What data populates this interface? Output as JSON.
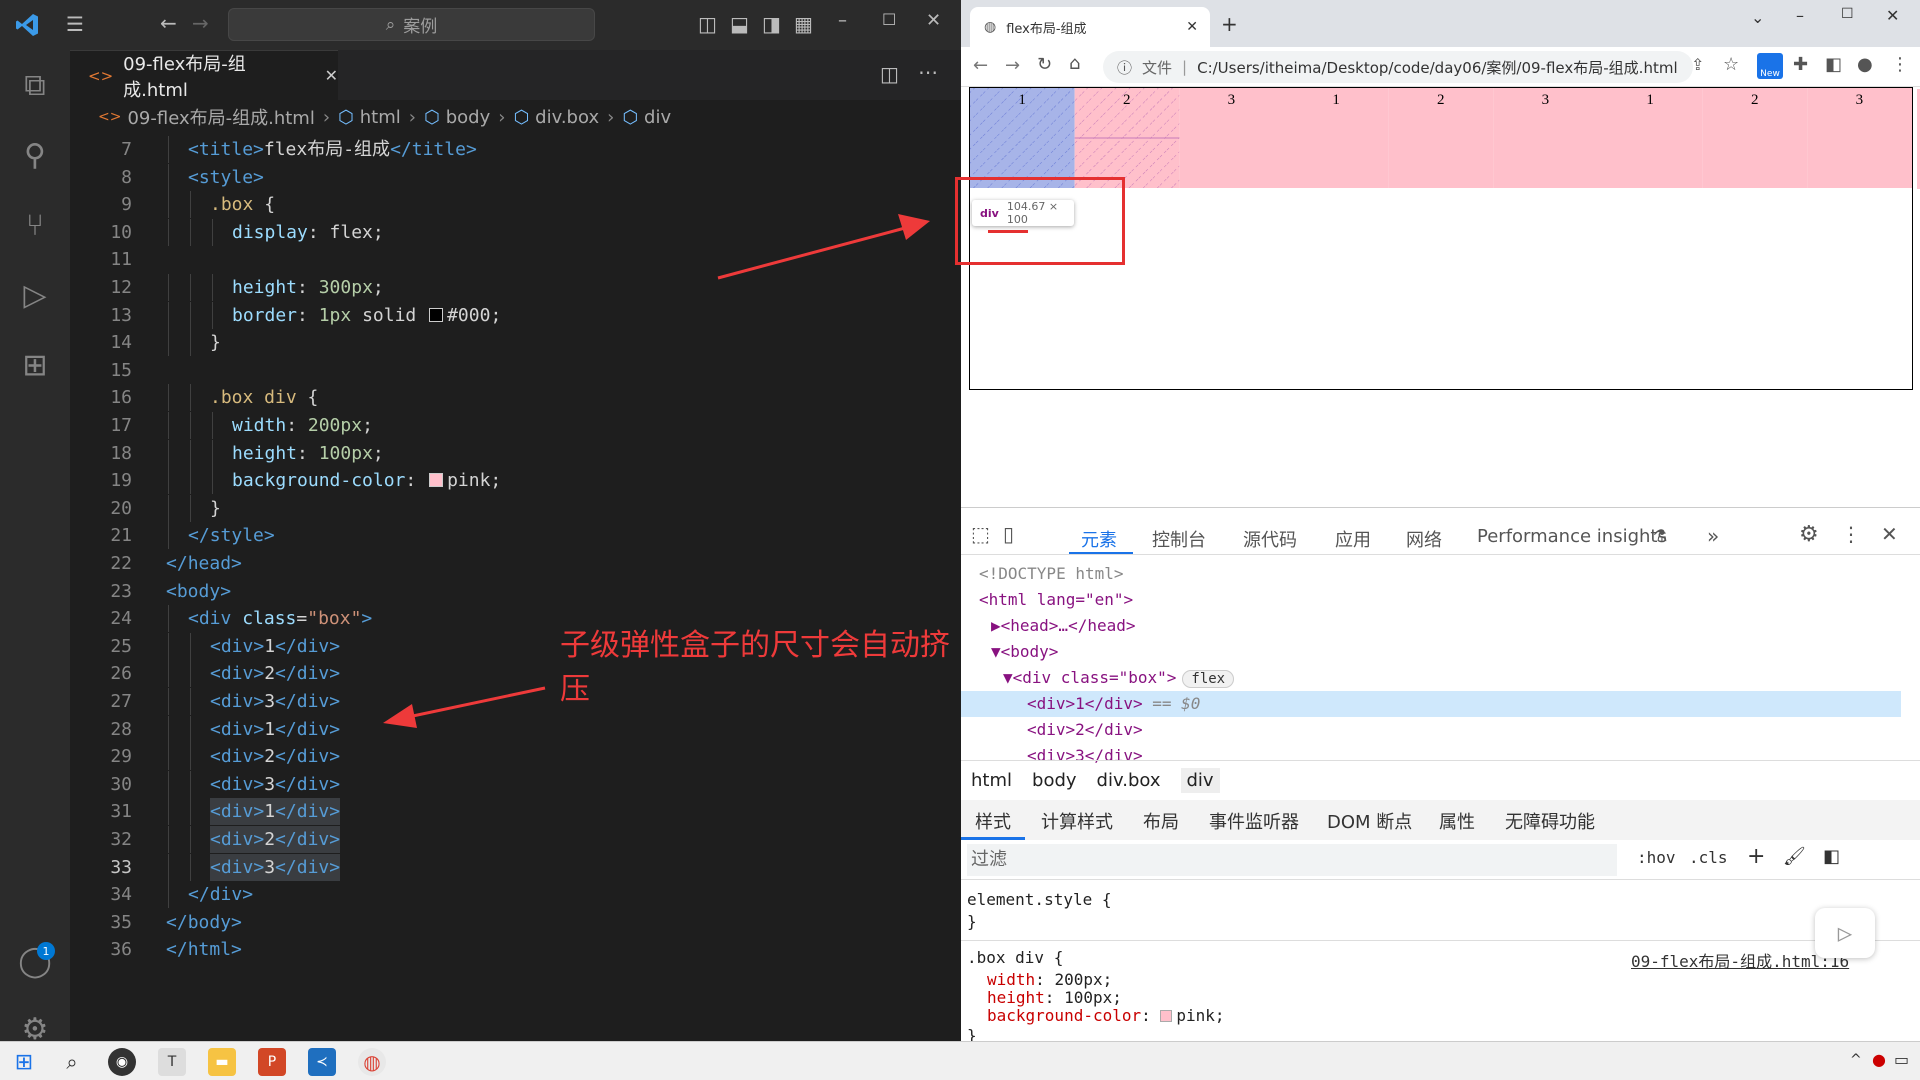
{
  "vscode": {
    "search_text": "案例",
    "tab_label": "09-flex布局-组成.html",
    "breadcrumb": [
      "09-flex布局-组成.html",
      "html",
      "body",
      "div.box",
      "div"
    ],
    "account_badge": "1",
    "lines": [
      {
        "n": "7",
        "parts": [
          [
            "t",
            "<"
          ],
          [
            "t",
            "title"
          ],
          [
            "t",
            ">"
          ],
          [
            "txt",
            "flex布局-组成"
          ],
          [
            "t",
            "</"
          ],
          [
            "t",
            "title"
          ],
          [
            "t",
            ">"
          ]
        ],
        "indent": 1
      },
      {
        "n": "8",
        "parts": [
          [
            "t",
            "<"
          ],
          [
            "t",
            "style"
          ],
          [
            "t",
            ">"
          ]
        ],
        "indent": 1
      },
      {
        "n": "9",
        "parts": [
          [
            "sel",
            ".box"
          ],
          [
            "txt",
            " {"
          ]
        ],
        "indent": 2
      },
      {
        "n": "10",
        "parts": [
          [
            "pr",
            "display"
          ],
          [
            "txt",
            ": flex;"
          ]
        ],
        "indent": 3
      },
      {
        "n": "11",
        "parts": [],
        "indent": 0
      },
      {
        "n": "12",
        "parts": [
          [
            "pr",
            "height"
          ],
          [
            "txt",
            ": "
          ],
          [
            "num",
            "300px"
          ],
          [
            "txt",
            ";"
          ]
        ],
        "indent": 3
      },
      {
        "n": "13",
        "parts": [
          [
            "pr",
            "border"
          ],
          [
            "txt",
            ": "
          ],
          [
            "num",
            "1px"
          ],
          [
            "txt",
            " solid "
          ],
          [
            "sw",
            "#000000"
          ],
          [
            "txt",
            "#000;"
          ]
        ],
        "indent": 3
      },
      {
        "n": "14",
        "parts": [
          [
            "txt",
            "}"
          ]
        ],
        "indent": 2
      },
      {
        "n": "15",
        "parts": [],
        "indent": 0
      },
      {
        "n": "16",
        "parts": [
          [
            "sel",
            ".box div"
          ],
          [
            "txt",
            " {"
          ]
        ],
        "indent": 2
      },
      {
        "n": "17",
        "parts": [
          [
            "pr",
            "width"
          ],
          [
            "txt",
            ": "
          ],
          [
            "num",
            "200px"
          ],
          [
            "txt",
            ";"
          ]
        ],
        "indent": 3
      },
      {
        "n": "18",
        "parts": [
          [
            "pr",
            "height"
          ],
          [
            "txt",
            ": "
          ],
          [
            "num",
            "100px"
          ],
          [
            "txt",
            ";"
          ]
        ],
        "indent": 3
      },
      {
        "n": "19",
        "parts": [
          [
            "pr",
            "background-color"
          ],
          [
            "txt",
            ": "
          ],
          [
            "sw",
            "#ffc0cb"
          ],
          [
            "txt",
            "pink;"
          ]
        ],
        "indent": 3
      },
      {
        "n": "20",
        "parts": [
          [
            "txt",
            "}"
          ]
        ],
        "indent": 2
      },
      {
        "n": "21",
        "parts": [
          [
            "t",
            "</"
          ],
          [
            "t",
            "style"
          ],
          [
            "t",
            ">"
          ]
        ],
        "indent": 1
      },
      {
        "n": "22",
        "parts": [
          [
            "t",
            "</"
          ],
          [
            "t",
            "head"
          ],
          [
            "t",
            ">"
          ]
        ],
        "indent": 0
      },
      {
        "n": "23",
        "parts": [
          [
            "t",
            "<"
          ],
          [
            "t",
            "body"
          ],
          [
            "t",
            ">"
          ]
        ],
        "indent": 0
      },
      {
        "n": "24",
        "parts": [
          [
            "t",
            "<"
          ],
          [
            "t",
            "div"
          ],
          [
            "at",
            " class"
          ],
          [
            "txt",
            "="
          ],
          [
            "str",
            "\"box\""
          ],
          [
            "t",
            ">"
          ]
        ],
        "indent": 1
      },
      {
        "n": "25",
        "parts": [
          [
            "t",
            "<"
          ],
          [
            "t",
            "div"
          ],
          [
            "t",
            ">"
          ],
          [
            "txt",
            "1"
          ],
          [
            "t",
            "</"
          ],
          [
            "t",
            "div"
          ],
          [
            "t",
            ">"
          ]
        ],
        "indent": 2
      },
      {
        "n": "26",
        "parts": [
          [
            "t",
            "<"
          ],
          [
            "t",
            "div"
          ],
          [
            "t",
            ">"
          ],
          [
            "txt",
            "2"
          ],
          [
            "t",
            "</"
          ],
          [
            "t",
            "div"
          ],
          [
            "t",
            ">"
          ]
        ],
        "indent": 2
      },
      {
        "n": "27",
        "parts": [
          [
            "t",
            "<"
          ],
          [
            "t",
            "div"
          ],
          [
            "t",
            ">"
          ],
          [
            "txt",
            "3"
          ],
          [
            "t",
            "</"
          ],
          [
            "t",
            "div"
          ],
          [
            "t",
            ">"
          ]
        ],
        "indent": 2
      },
      {
        "n": "28",
        "parts": [
          [
            "t",
            "<"
          ],
          [
            "t",
            "div"
          ],
          [
            "t",
            ">"
          ],
          [
            "txt",
            "1"
          ],
          [
            "t",
            "</"
          ],
          [
            "t",
            "div"
          ],
          [
            "t",
            ">"
          ]
        ],
        "indent": 2
      },
      {
        "n": "29",
        "parts": [
          [
            "t",
            "<"
          ],
          [
            "t",
            "div"
          ],
          [
            "t",
            ">"
          ],
          [
            "txt",
            "2"
          ],
          [
            "t",
            "</"
          ],
          [
            "t",
            "div"
          ],
          [
            "t",
            ">"
          ]
        ],
        "indent": 2
      },
      {
        "n": "30",
        "parts": [
          [
            "t",
            "<"
          ],
          [
            "t",
            "div"
          ],
          [
            "t",
            ">"
          ],
          [
            "txt",
            "3"
          ],
          [
            "t",
            "</"
          ],
          [
            "t",
            "div"
          ],
          [
            "t",
            ">"
          ]
        ],
        "indent": 2
      },
      {
        "n": "31",
        "parts": [
          [
            "t",
            "<"
          ],
          [
            "t",
            "div"
          ],
          [
            "t",
            ">"
          ],
          [
            "txt",
            "1"
          ],
          [
            "t",
            "</"
          ],
          [
            "t",
            "div"
          ],
          [
            "t",
            ">"
          ]
        ],
        "indent": 2,
        "hl": true
      },
      {
        "n": "32",
        "parts": [
          [
            "t",
            "<"
          ],
          [
            "t",
            "div"
          ],
          [
            "t",
            ">"
          ],
          [
            "txt",
            "2"
          ],
          [
            "t",
            "</"
          ],
          [
            "t",
            "div"
          ],
          [
            "t",
            ">"
          ]
        ],
        "indent": 2,
        "hl": true
      },
      {
        "n": "33",
        "parts": [
          [
            "t",
            "<"
          ],
          [
            "t",
            "div"
          ],
          [
            "t",
            ">"
          ],
          [
            "txt",
            "3"
          ],
          [
            "t",
            "</"
          ],
          [
            "t",
            "div"
          ],
          [
            "t",
            ">"
          ]
        ],
        "indent": 2,
        "hl": true
      },
      {
        "n": "34",
        "parts": [
          [
            "t",
            "</"
          ],
          [
            "t",
            "div"
          ],
          [
            "t",
            ">"
          ]
        ],
        "indent": 1
      },
      {
        "n": "35",
        "parts": [
          [
            "t",
            "</"
          ],
          [
            "t",
            "body"
          ],
          [
            "t",
            ">"
          ]
        ],
        "indent": 0
      },
      {
        "n": "36",
        "parts": [
          [
            "t",
            "</"
          ],
          [
            "t",
            "html"
          ],
          [
            "t",
            ">"
          ]
        ],
        "indent": 0
      }
    ],
    "annotation": "子级弹性盒子的尺寸会自动挤压"
  },
  "browser": {
    "tab_title": "flex布局-组成",
    "url_label": "文件",
    "url": "C:/Users/itheima/Desktop/code/day06/案例/09-flex布局-组成.html",
    "new_badge": "New",
    "flex_items": [
      "1",
      "2",
      "3",
      "1",
      "2",
      "3",
      "1",
      "2",
      "3"
    ],
    "tooltip_tag": "div",
    "tooltip_size": "104.67 × 100",
    "devtools_tabs": [
      "元素",
      "控制台",
      "源代码",
      "应用",
      "网络",
      "Performance insights"
    ],
    "dom_lines": [
      {
        "text": "<!DOCTYPE html>",
        "indent": 0,
        "cls": "dc"
      },
      {
        "text": "<html lang=\"en\">",
        "indent": 0,
        "cls": "dt"
      },
      {
        "text": "▶<head>…</head>",
        "indent": 1,
        "cls": "dt"
      },
      {
        "text": "▼<body>",
        "indent": 1,
        "cls": "dt"
      },
      {
        "text": "▼<div class=\"box\">",
        "indent": 2,
        "cls": "dt",
        "badge": "flex"
      },
      {
        "text": "<div>1</div>",
        "indent": 4,
        "cls": "dt",
        "suffix": " == $0",
        "selected": true
      },
      {
        "text": "<div>2</div>",
        "indent": 4,
        "cls": "dt"
      },
      {
        "text": "<div>3</div>",
        "indent": 4,
        "cls": "dt"
      }
    ],
    "crumbs": [
      "html",
      "body",
      "div.box",
      "div"
    ],
    "sub_tabs": [
      "样式",
      "计算样式",
      "布局",
      "事件监听器",
      "DOM 断点",
      "属性",
      "无障碍功能"
    ],
    "filter_placeholder": "过滤",
    "hov": ":hov",
    "cls": ".cls",
    "element_style": "element.style {",
    "close_brace": "}",
    "rule_selector": ".box div {",
    "rule_source": "09-flex布局-组成.html:16",
    "rule_props": [
      {
        "name": "width",
        "value": "200px;"
      },
      {
        "name": "height",
        "value": "100px;"
      },
      {
        "name": "background-color",
        "value": "pink;"
      }
    ]
  }
}
